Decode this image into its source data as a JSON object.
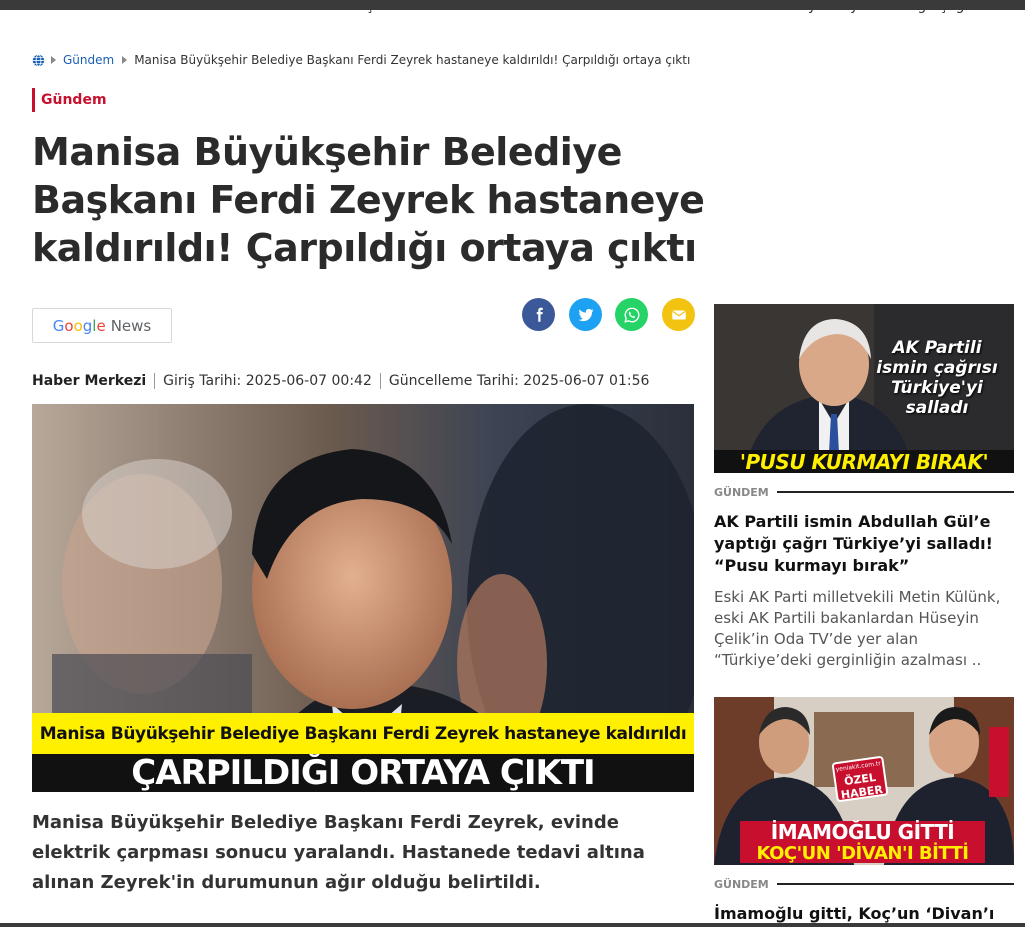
{
  "top_snippets": {
    "left": "açıkladılar...",
    "right": "yetkiliyi bakanlığa çağırdı"
  },
  "breadcrumb": {
    "home_icon": "globe-icon",
    "section": "Gündem",
    "current": "Manisa Büyükşehir Belediye Başkanı Ferdi Zeyrek hastaneye kaldırıldı! Çarpıldığı ortaya çıktı"
  },
  "article": {
    "category": "Gündem",
    "headline": "Manisa Büyükşehir Belediye Başkanı Ferdi Zeyrek hastaneye kaldırıldı! Çarpıldığı ortaya çıktı",
    "google_news": {
      "g1": "G",
      "g2": "o",
      "g3": "o",
      "g4": "g",
      "g5": "l",
      "g6": "e",
      "news": "News"
    },
    "share_buttons": [
      "facebook-icon",
      "twitter-icon",
      "whatsapp-icon",
      "mail-icon"
    ],
    "author": "Haber Merkezi",
    "published": "Giriş Tarihi: 2025-06-07 00:42",
    "updated": "Güncelleme Tarihi: 2025-06-07 01:56",
    "hero_caption_top": "Manisa Büyükşehir Belediye Başkanı Ferdi Zeyrek hastaneye kaldırıldı",
    "hero_caption_bottom": "ÇARPILDIĞI ORTAYA ÇIKTI",
    "lead": "Manisa Büyükşehir Belediye Başkanı Ferdi Zeyrek, evinde elektrik çarpması sonucu yaralandı. Hastanede tedavi altına alınan Zeyrek'in durumunun ağır olduğu belirtildi."
  },
  "sidebar": {
    "cards": [
      {
        "image_overlay": "AK Partili ismin çağrısı Türkiye'yi salladı",
        "image_banner": "'PUSU KURMAYI BIRAK'",
        "category": "GÜNDEM",
        "title": "AK Partili ismin Abdullah Gül’e yaptığı çağrı Türkiye’yi salladı! “Pusu kurmayı bırak”",
        "summary": "Eski AK Parti milletvekili Metin Külünk, eski AK Partili bakanlardan Hüseyin Çelik’in Oda TV’de yer alan “Türkiye’deki gerginliğin azalması .."
      },
      {
        "badge_site": "yeniakit.com.tr",
        "badge_line1": "ÖZEL",
        "badge_line2": "HABER",
        "image_banner_top": "İMAMOĞLU GİTTİ",
        "image_banner_bottom": "KOÇ'UN 'DİVAN'I BİTTİ",
        "category": "GÜNDEM",
        "title": "İmamoğlu gitti, Koç’un ‘Divan’ı bitti"
      }
    ]
  },
  "colors": {
    "accent": "#c8102e",
    "link": "#1a5fb4",
    "facebook": "#3b5998",
    "twitter": "#1da1f2",
    "whatsapp": "#25d366",
    "mail": "#f2c311",
    "caption_yellow": "#fff000"
  }
}
